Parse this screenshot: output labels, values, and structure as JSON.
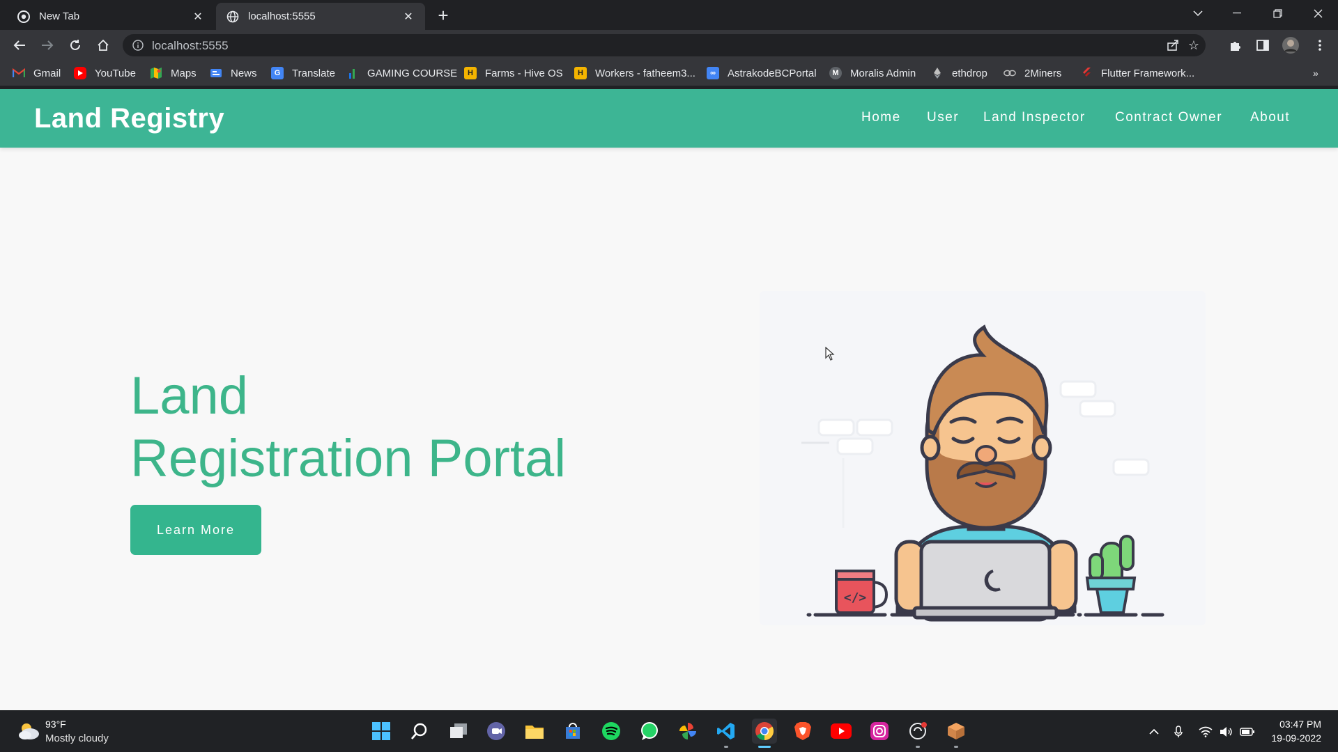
{
  "browser": {
    "tabs": [
      {
        "title": "New Tab",
        "icon": "chrome-icon",
        "active": false
      },
      {
        "title": "localhost:5555",
        "icon": "globe-icon",
        "active": true
      }
    ],
    "url": "localhost:5555",
    "bookmarks": [
      {
        "label": "Gmail",
        "icon": "gmail-icon",
        "color": "#ea4335"
      },
      {
        "label": "YouTube",
        "icon": "youtube-icon",
        "color": "#ff0000"
      },
      {
        "label": "Maps",
        "icon": "maps-icon",
        "color": "#34a853"
      },
      {
        "label": "News",
        "icon": "news-icon",
        "color": "#4285f4"
      },
      {
        "label": "Translate",
        "icon": "translate-icon",
        "color": "#4285f4"
      },
      {
        "label": "GAMING COURSE",
        "icon": "bar-chart-icon",
        "color": "#1a73e8"
      },
      {
        "label": "Farms - Hive OS",
        "icon": "hive-icon",
        "color": "#f4b400"
      },
      {
        "label": "Workers - fatheem3...",
        "icon": "hive-icon",
        "color": "#f4b400"
      },
      {
        "label": "AstrakodeBCPortal",
        "icon": "link-icon",
        "color": "#4285f4"
      },
      {
        "label": "Moralis Admin",
        "icon": "moralis-icon",
        "color": "#5f6368"
      },
      {
        "label": "ethdrop",
        "icon": "ethereum-icon",
        "color": "#9aa0a6"
      },
      {
        "label": "2Miners",
        "icon": "miners-icon",
        "color": "#9aa0a6"
      },
      {
        "label": "Flutter Framework...",
        "icon": "flutter-icon",
        "color": "#e53935"
      }
    ]
  },
  "site": {
    "brand": "Land Registry",
    "nav": [
      "Home",
      "User",
      "Land Inspector",
      "Contract Owner",
      "About"
    ],
    "hero": {
      "line1": "Land",
      "line2": "Registration Portal",
      "button": "Learn More"
    },
    "accent": "#3db595"
  },
  "taskbar": {
    "weather_temp": "93°F",
    "weather_desc": "Mostly cloudy",
    "time": "03:47 PM",
    "date": "19-09-2022",
    "apps": [
      "windows-start-icon",
      "search-icon",
      "task-view-icon",
      "teams-chat-icon",
      "file-explorer-icon",
      "microsoft-store-icon",
      "spotify-icon",
      "whatsapp-icon",
      "photos-icon",
      "vscode-icon",
      "chrome-icon",
      "brave-icon",
      "youtube-icon",
      "instagram-icon",
      "app-icon",
      "box-icon"
    ],
    "tray": [
      "chevron-up-icon",
      "microphone-icon",
      "wifi-icon",
      "volume-icon",
      "battery-icon"
    ]
  }
}
